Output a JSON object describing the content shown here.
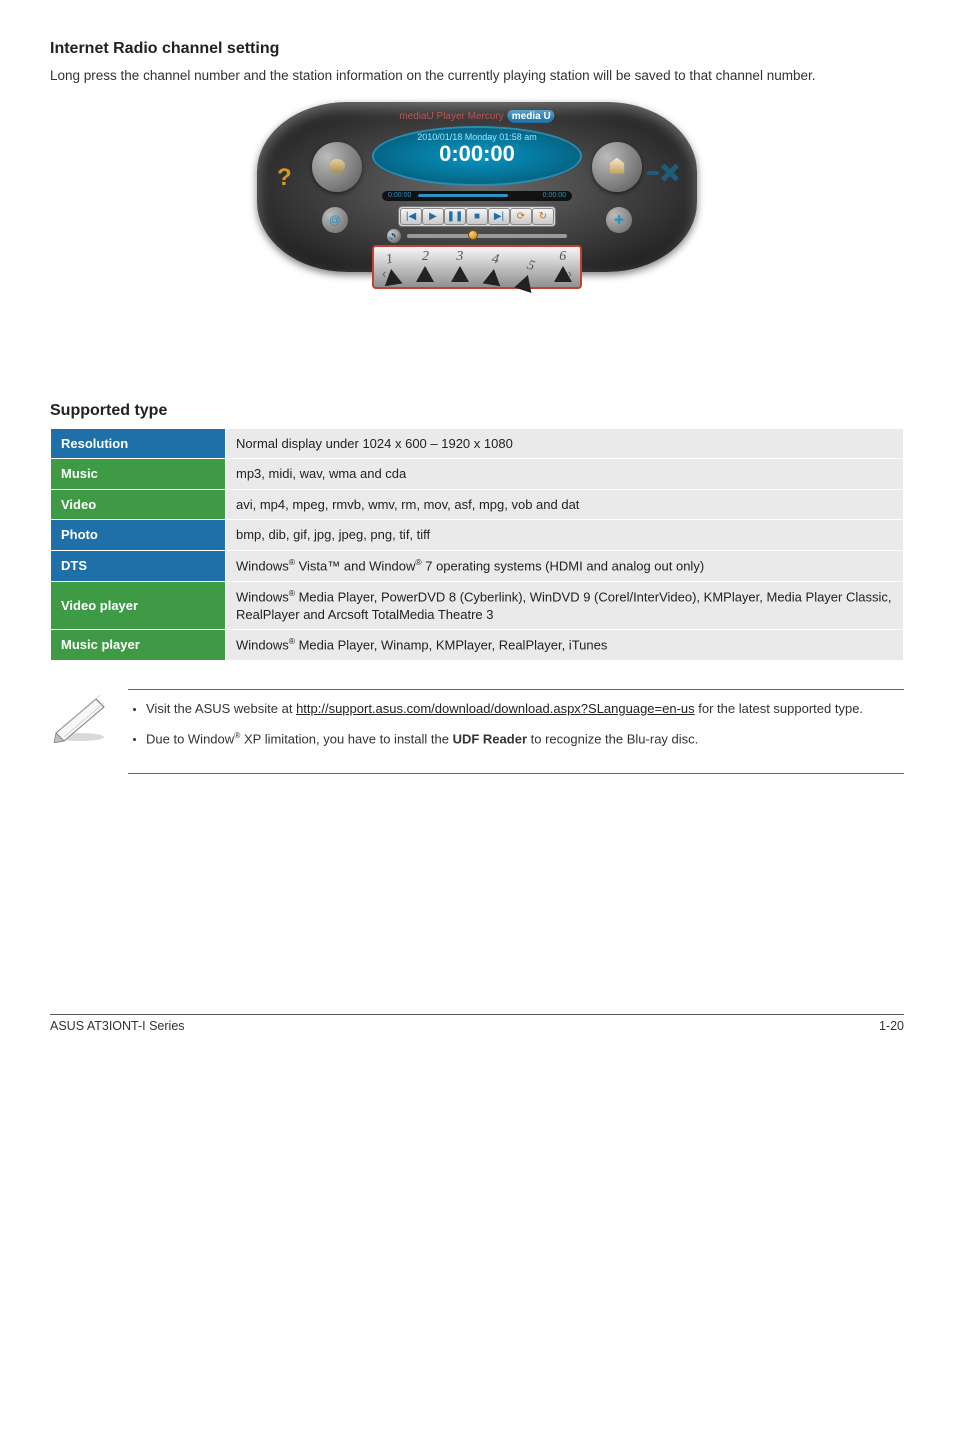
{
  "section1": {
    "heading": "Internet Radio channel setting",
    "body": "Long press the channel number and the station information on the currently playing station will be saved to that channel number."
  },
  "player": {
    "logo_prefix": "mediaU Player Mercury",
    "logo_badge": "media U",
    "date_line": "2010/01/18  Monday  01:58 am",
    "main_time": "0:00:00",
    "elapsed": "0:00:00",
    "remaining": "0:00:00",
    "presets": [
      "1",
      "2",
      "3",
      "4",
      "5",
      "6"
    ]
  },
  "section2": {
    "heading": "Supported type",
    "rows": [
      {
        "label": "Resolution",
        "cls": "blue",
        "value_html": "Normal display under 1024 x 600 – 1920 x 1080"
      },
      {
        "label": "Music",
        "cls": "green",
        "value_html": "mp3, midi, wav, wma and cda"
      },
      {
        "label": "Video",
        "cls": "green",
        "value_html": "avi, mp4, mpeg, rmvb, wmv, rm, mov, asf, mpg, vob and dat"
      },
      {
        "label": "Photo",
        "cls": "blue",
        "value_html": "bmp, dib, gif, jpg, jpeg, png, tif, tiff"
      },
      {
        "label": "DTS",
        "cls": "blue",
        "value_html": "Windows<sup>®</sup> Vista™ and Window<sup>®</sup> 7 operating systems (HDMI and analog out only)"
      },
      {
        "label": "Video player",
        "cls": "green",
        "value_html": "Windows<sup>®</sup> Media Player, PowerDVD 8 (Cyberlink), WinDVD 9 (Corel/InterVideo), KMPlayer, Media Player Classic, RealPlayer and Arcsoft TotalMedia Theatre 3"
      },
      {
        "label": "Music player",
        "cls": "green",
        "value_html": "Windows<sup>®</sup> Media Player, Winamp, KMPlayer, RealPlayer, iTunes"
      }
    ]
  },
  "notes": {
    "items": [
      "Visit the ASUS website at <a href=\"#\">http://support.asus.com/download/download.aspx?SLanguage=en-us</a> for the latest supported type.",
      "Due to Window<sup>®</sup> XP limitation, you have to install the <b>UDF Reader</b> to recognize the Blu-ray disc."
    ]
  },
  "footer": {
    "left": "ASUS AT3IONT-I Series",
    "right": "1-20"
  }
}
